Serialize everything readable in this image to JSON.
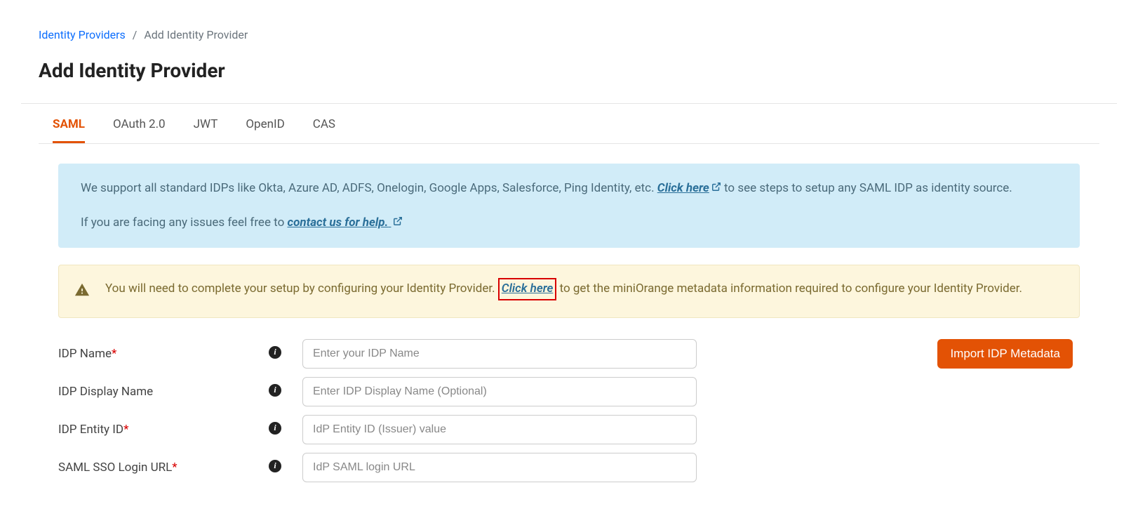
{
  "breadcrumb": {
    "root": "Identity Providers",
    "sep": "/",
    "current": "Add Identity Provider"
  },
  "page_title": "Add Identity Provider",
  "tabs": [
    "SAML",
    "OAuth 2.0",
    "JWT",
    "OpenID",
    "CAS"
  ],
  "info": {
    "text1a": "We support all standard IDPs like Okta, Azure AD, ADFS, Onelogin, Google Apps, Salesforce, Ping Identity, etc. ",
    "link1": "Click here",
    "text1b": " to see steps to setup any SAML IDP as identity source.",
    "text2a": "If you are facing any issues feel free to ",
    "link2": "contact us for help."
  },
  "warn": {
    "text_a": "You will need to complete your setup by configuring your Identity Provider. ",
    "link": "Click here",
    "text_b": " to get the miniOrange metadata information required to configure your Identity Provider."
  },
  "form": {
    "fields": [
      {
        "label": "IDP Name",
        "required": true,
        "placeholder": "Enter your IDP Name"
      },
      {
        "label": "IDP Display Name",
        "required": false,
        "placeholder": "Enter IDP Display Name (Optional)"
      },
      {
        "label": "IDP Entity ID",
        "required": true,
        "placeholder": "IdP Entity ID (Issuer) value"
      },
      {
        "label": "SAML SSO Login URL",
        "required": true,
        "placeholder": "IdP SAML login URL"
      }
    ],
    "import_btn": "Import IDP Metadata",
    "req_mark": "*"
  }
}
